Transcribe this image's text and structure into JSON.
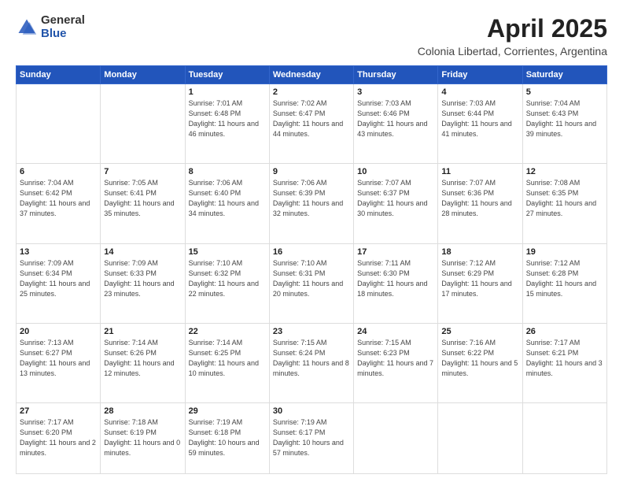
{
  "logo": {
    "general": "General",
    "blue": "Blue"
  },
  "title": {
    "month": "April 2025",
    "location": "Colonia Libertad, Corrientes, Argentina"
  },
  "days": [
    "Sunday",
    "Monday",
    "Tuesday",
    "Wednesday",
    "Thursday",
    "Friday",
    "Saturday"
  ],
  "weeks": [
    [
      {
        "day": "",
        "info": ""
      },
      {
        "day": "",
        "info": ""
      },
      {
        "day": "1",
        "info": "Sunrise: 7:01 AM\nSunset: 6:48 PM\nDaylight: 11 hours and 46 minutes."
      },
      {
        "day": "2",
        "info": "Sunrise: 7:02 AM\nSunset: 6:47 PM\nDaylight: 11 hours and 44 minutes."
      },
      {
        "day": "3",
        "info": "Sunrise: 7:03 AM\nSunset: 6:46 PM\nDaylight: 11 hours and 43 minutes."
      },
      {
        "day": "4",
        "info": "Sunrise: 7:03 AM\nSunset: 6:44 PM\nDaylight: 11 hours and 41 minutes."
      },
      {
        "day": "5",
        "info": "Sunrise: 7:04 AM\nSunset: 6:43 PM\nDaylight: 11 hours and 39 minutes."
      }
    ],
    [
      {
        "day": "6",
        "info": "Sunrise: 7:04 AM\nSunset: 6:42 PM\nDaylight: 11 hours and 37 minutes."
      },
      {
        "day": "7",
        "info": "Sunrise: 7:05 AM\nSunset: 6:41 PM\nDaylight: 11 hours and 35 minutes."
      },
      {
        "day": "8",
        "info": "Sunrise: 7:06 AM\nSunset: 6:40 PM\nDaylight: 11 hours and 34 minutes."
      },
      {
        "day": "9",
        "info": "Sunrise: 7:06 AM\nSunset: 6:39 PM\nDaylight: 11 hours and 32 minutes."
      },
      {
        "day": "10",
        "info": "Sunrise: 7:07 AM\nSunset: 6:37 PM\nDaylight: 11 hours and 30 minutes."
      },
      {
        "day": "11",
        "info": "Sunrise: 7:07 AM\nSunset: 6:36 PM\nDaylight: 11 hours and 28 minutes."
      },
      {
        "day": "12",
        "info": "Sunrise: 7:08 AM\nSunset: 6:35 PM\nDaylight: 11 hours and 27 minutes."
      }
    ],
    [
      {
        "day": "13",
        "info": "Sunrise: 7:09 AM\nSunset: 6:34 PM\nDaylight: 11 hours and 25 minutes."
      },
      {
        "day": "14",
        "info": "Sunrise: 7:09 AM\nSunset: 6:33 PM\nDaylight: 11 hours and 23 minutes."
      },
      {
        "day": "15",
        "info": "Sunrise: 7:10 AM\nSunset: 6:32 PM\nDaylight: 11 hours and 22 minutes."
      },
      {
        "day": "16",
        "info": "Sunrise: 7:10 AM\nSunset: 6:31 PM\nDaylight: 11 hours and 20 minutes."
      },
      {
        "day": "17",
        "info": "Sunrise: 7:11 AM\nSunset: 6:30 PM\nDaylight: 11 hours and 18 minutes."
      },
      {
        "day": "18",
        "info": "Sunrise: 7:12 AM\nSunset: 6:29 PM\nDaylight: 11 hours and 17 minutes."
      },
      {
        "day": "19",
        "info": "Sunrise: 7:12 AM\nSunset: 6:28 PM\nDaylight: 11 hours and 15 minutes."
      }
    ],
    [
      {
        "day": "20",
        "info": "Sunrise: 7:13 AM\nSunset: 6:27 PM\nDaylight: 11 hours and 13 minutes."
      },
      {
        "day": "21",
        "info": "Sunrise: 7:14 AM\nSunset: 6:26 PM\nDaylight: 11 hours and 12 minutes."
      },
      {
        "day": "22",
        "info": "Sunrise: 7:14 AM\nSunset: 6:25 PM\nDaylight: 11 hours and 10 minutes."
      },
      {
        "day": "23",
        "info": "Sunrise: 7:15 AM\nSunset: 6:24 PM\nDaylight: 11 hours and 8 minutes."
      },
      {
        "day": "24",
        "info": "Sunrise: 7:15 AM\nSunset: 6:23 PM\nDaylight: 11 hours and 7 minutes."
      },
      {
        "day": "25",
        "info": "Sunrise: 7:16 AM\nSunset: 6:22 PM\nDaylight: 11 hours and 5 minutes."
      },
      {
        "day": "26",
        "info": "Sunrise: 7:17 AM\nSunset: 6:21 PM\nDaylight: 11 hours and 3 minutes."
      }
    ],
    [
      {
        "day": "27",
        "info": "Sunrise: 7:17 AM\nSunset: 6:20 PM\nDaylight: 11 hours and 2 minutes."
      },
      {
        "day": "28",
        "info": "Sunrise: 7:18 AM\nSunset: 6:19 PM\nDaylight: 11 hours and 0 minutes."
      },
      {
        "day": "29",
        "info": "Sunrise: 7:19 AM\nSunset: 6:18 PM\nDaylight: 10 hours and 59 minutes."
      },
      {
        "day": "30",
        "info": "Sunrise: 7:19 AM\nSunset: 6:17 PM\nDaylight: 10 hours and 57 minutes."
      },
      {
        "day": "",
        "info": ""
      },
      {
        "day": "",
        "info": ""
      },
      {
        "day": "",
        "info": ""
      }
    ]
  ]
}
